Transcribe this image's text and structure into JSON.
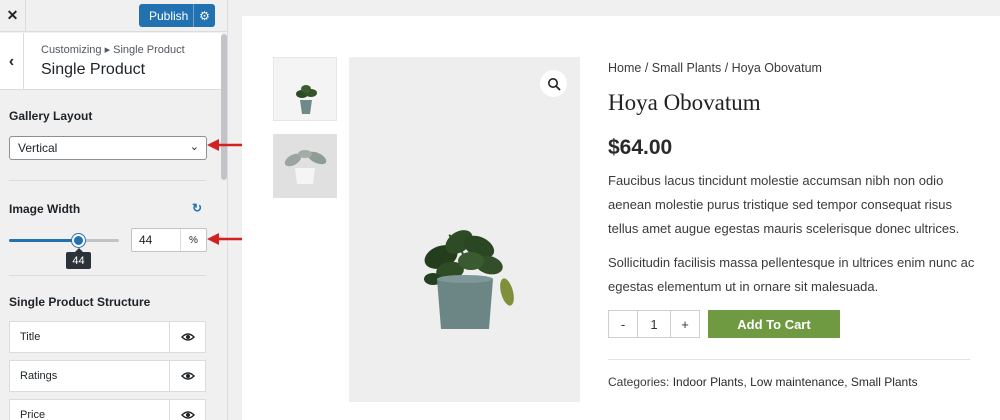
{
  "topbar": {
    "close_icon": "close-icon",
    "publish_label": "Publish",
    "settings_icon": "gear-icon"
  },
  "panel": {
    "breadcrumb": "Customizing ▸ Single Product",
    "title": "Single Product"
  },
  "gallery_layout": {
    "label": "Gallery Layout",
    "selected": "Vertical"
  },
  "image_width": {
    "label": "Image Width",
    "value": "44",
    "unit": "%",
    "tooltip": "44",
    "fraction": 0.44
  },
  "structure": {
    "label": "Single Product Structure",
    "items": [
      {
        "label": "Title"
      },
      {
        "label": "Ratings"
      },
      {
        "label": "Price"
      }
    ]
  },
  "product": {
    "breadcrumb": "Home / Small Plants / Hoya Obovatum",
    "title": "Hoya Obovatum",
    "price": "$64.00",
    "description_1": "Faucibus lacus tincidunt molestie accumsan nibh non odio aenean molestie purus tristique sed tempor consequat risus tellus amet augue egestas mauris scelerisque donec ultrices.",
    "description_2": "Sollicitudin facilisis massa pellentesque in ultrices enim nunc ac egestas elementum ut in ornare sit malesuada.",
    "qty_minus": "-",
    "qty_value": "1",
    "qty_plus": "+",
    "add_to_cart": "Add To Cart",
    "categories_label": "Categories:",
    "categories": [
      "Indoor Plants",
      "Low maintenance",
      "Small Plants"
    ],
    "category_sep": ","
  },
  "colors": {
    "accent": "#2271b1",
    "cart_button": "#709a41",
    "annotation_arrow": "#d32121"
  }
}
